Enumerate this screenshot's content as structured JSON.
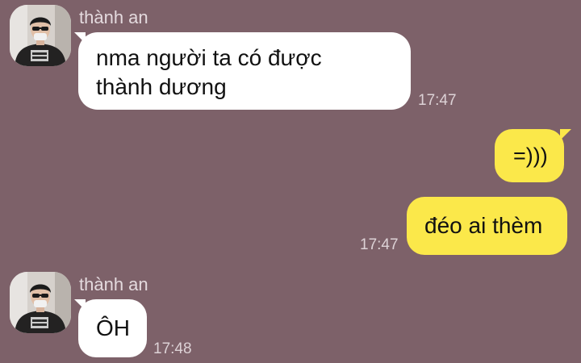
{
  "colors": {
    "background": "#7d6169",
    "incoming_bubble": "#ffffff",
    "outgoing_bubble": "#fbe84a",
    "sender_name": "#e4dade",
    "timestamp": "#ddd2d6"
  },
  "messages": [
    {
      "direction": "incoming",
      "sender": "thành an",
      "avatar_icon": "user-avatar-photo",
      "lines": [
        "nma người ta có được",
        "thành dương"
      ],
      "time": "17:47"
    },
    {
      "direction": "outgoing",
      "lines": [
        "=)))"
      ]
    },
    {
      "direction": "outgoing",
      "lines": [
        "đéo ai thèm"
      ],
      "time": "17:47"
    },
    {
      "direction": "incoming",
      "sender": "thành an",
      "avatar_icon": "user-avatar-photo",
      "lines": [
        "ÔH"
      ],
      "time": "17:48"
    }
  ]
}
